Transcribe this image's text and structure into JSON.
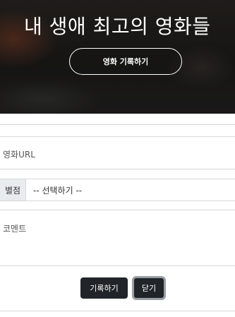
{
  "hero": {
    "title": "내 생애 최고의 영화들",
    "record_button_label": "영화 기록하기"
  },
  "form": {
    "url_placeholder": "영화URL",
    "rating_label": "별점",
    "rating_selected": "-- 선택하기 --",
    "comment_placeholder": "코멘트",
    "submit_label": "기록하기",
    "close_label": "닫기"
  }
}
